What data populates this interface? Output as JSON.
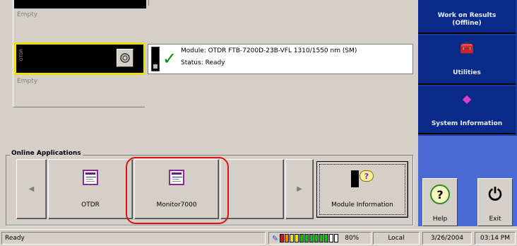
{
  "modules": {
    "slot1_empty": "Empty",
    "slot2_label": "OTDR",
    "slot2_empty": "Empty",
    "module_line": "Module:   OTDR FTB-7200D-23B-VFL 1310/1550 nm (SM)",
    "status_line": "Status:   Ready"
  },
  "online_apps": {
    "title": "Online Applications",
    "apps": [
      {
        "label": "OTDR"
      },
      {
        "label": "Monitor7000"
      }
    ],
    "module_information": "Module Information",
    "highlight_color": "#e01010"
  },
  "right_panel": {
    "work_on_results": "Work on Results\n(Offline)",
    "utilities": "Utilities",
    "system_information": "System Information",
    "help": "Help",
    "exit": "Exit",
    "panel_color": "#0a2a8a",
    "lower_color": "#4a6ad4"
  },
  "statusbar": {
    "status": "Ready",
    "battery_percent": "80%",
    "battery_level": 0.8,
    "location": "Local",
    "date": "3/26/2004",
    "time": "03:14 PM"
  }
}
